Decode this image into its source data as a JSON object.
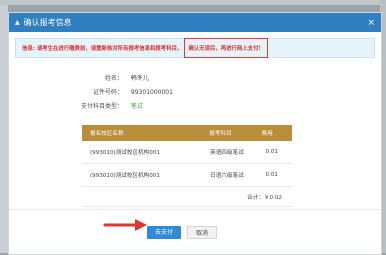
{
  "dialog": {
    "title": "确认报考信息",
    "close_icon": "close-icon"
  },
  "notice": {
    "text_main": "信息: 请考生在进行缴费前，请重新核对所有报考信息和报考科目，",
    "text_highlight": "确认无误后，再进行网上支付！"
  },
  "student": {
    "name_label": "姓名：",
    "name_value": "韩冬儿",
    "id_label": "证件号码：",
    "id_value": "99301000001",
    "pay_type_label": "支付科目类型：",
    "pay_type_value": "笔试"
  },
  "table": {
    "headers": [
      "报名校区名称",
      "报考科目",
      "费用"
    ],
    "rows": [
      [
        "(993010)测试校区机构001",
        "英语四级笔试",
        "0.01"
      ],
      [
        "(993010)测试校区机构001",
        "日语六级笔试",
        "0.01"
      ]
    ],
    "total": "合计：￥0.02"
  },
  "buttons": {
    "pay": "去支付",
    "cancel": "取消"
  },
  "colors": {
    "titlebar": "#2f7fc1",
    "table_header": "#b98d3a",
    "notice_text": "#e0312f",
    "pay_button": "#2e8bd4",
    "arrow": "#e1362f"
  }
}
